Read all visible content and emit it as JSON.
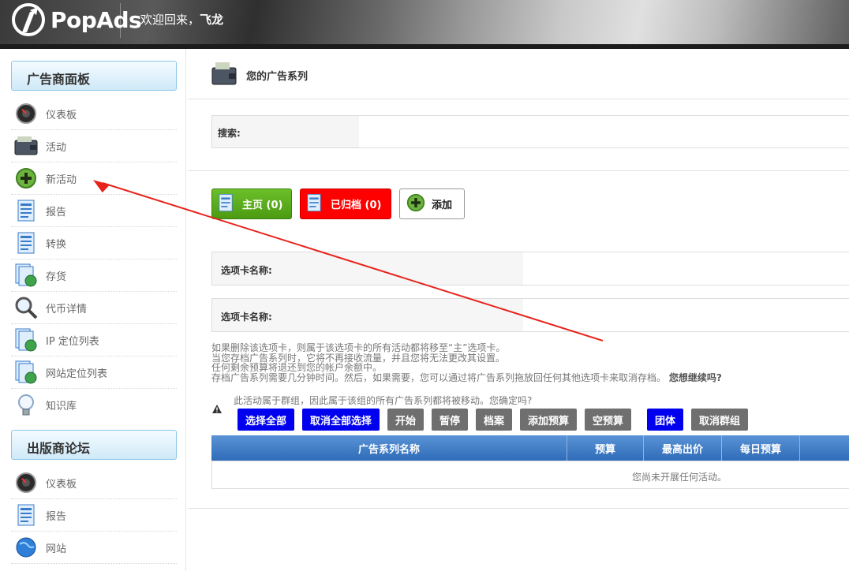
{
  "header": {
    "brand": "PopAds",
    "welcome": "欢迎回来，",
    "username": "飞龙"
  },
  "sidebar": {
    "section1": "广告商面板",
    "items1": [
      {
        "label": "仪表板",
        "icon": "dashboard-icon"
      },
      {
        "label": "活动",
        "icon": "wallet-icon"
      },
      {
        "label": "新活动",
        "icon": "plus-icon"
      },
      {
        "label": "报告",
        "icon": "report-icon"
      },
      {
        "label": "转换",
        "icon": "report-icon"
      },
      {
        "label": "存货",
        "icon": "inventory-icon"
      },
      {
        "label": "代币详情",
        "icon": "magnifier-icon"
      },
      {
        "label": "IP 定位列表",
        "icon": "inventory-icon"
      },
      {
        "label": "网站定位列表",
        "icon": "inventory-icon"
      },
      {
        "label": "知识库",
        "icon": "bulb-icon"
      }
    ],
    "section2": "出版商论坛",
    "items2": [
      {
        "label": "仪表板",
        "icon": "dashboard-icon"
      },
      {
        "label": "报告",
        "icon": "report-icon"
      },
      {
        "label": "网站",
        "icon": "globe-icon"
      }
    ]
  },
  "main": {
    "title": "您的广告系列",
    "search_label": "搜索:",
    "tabs": [
      {
        "label": "主页 (0)",
        "color": "#5aa61a"
      },
      {
        "label": "已归档 (0)",
        "color": "#ff0000"
      },
      {
        "label": "添加",
        "color": "#ffffff"
      }
    ],
    "tab_name_label_1": "选项卡名称:",
    "tab_name_label_2": "选项卡名称:",
    "notes": [
      "如果删除该选项卡，则属于该选项卡的所有活动都将移至“主”选项卡。",
      "当您存档广告系列时，它将不再接收流量，并且您将无法更改其设置。",
      "任何剩余预算将退还到您的帐户余额中。",
      "存档广告系列需要几分钟时间。然后，如果需要，您可以通过将广告系列拖放回任何其他选项卡来取消存档。"
    ],
    "notes_confirm": "您想继续吗?",
    "group_warning": "此活动属于群组，因此属于该组的所有广告系列都将被移动。您确定吗?",
    "actions": [
      {
        "label": "选择全部",
        "style": "blue"
      },
      {
        "label": "取消全部选择",
        "style": "blue"
      },
      {
        "label": "开始",
        "style": "gray"
      },
      {
        "label": "暂停",
        "style": "gray"
      },
      {
        "label": "档案",
        "style": "gray"
      },
      {
        "label": "添加预算",
        "style": "gray"
      },
      {
        "label": "空预算",
        "style": "gray"
      },
      {
        "label": "团体",
        "style": "blue"
      },
      {
        "label": "取消群组",
        "style": "gray"
      }
    ],
    "table": {
      "columns": [
        "广告系列名称",
        "预算",
        "最高出价",
        "每日预算"
      ],
      "empty_message": "您尚未开展任何活动。"
    }
  }
}
